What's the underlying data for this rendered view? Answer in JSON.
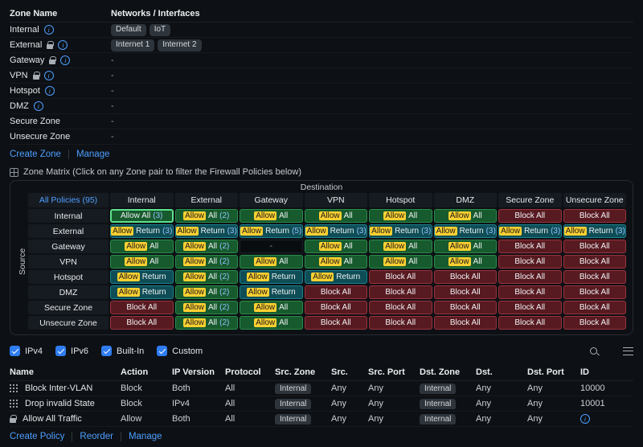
{
  "colors": {
    "accent": "#4d9fff",
    "allow_bg": "#175a2e",
    "allow_border": "#2c8c49",
    "return_bg": "#0f4d56",
    "return_border": "#1a828f",
    "block_bg": "#581a21",
    "block_border": "#99333d",
    "highlight_bg": "#fdd031",
    "count_text": "#8fc3ff",
    "selected_border": "#5fe08d"
  },
  "zones": {
    "columns": {
      "name": "Zone Name",
      "networks": "Networks / Interfaces"
    },
    "rows": [
      {
        "name": "Internal",
        "locked": false,
        "info": true,
        "networks": [
          "Default",
          "IoT"
        ]
      },
      {
        "name": "External",
        "locked": true,
        "info": true,
        "networks": [
          "Internet 1",
          "Internet 2"
        ]
      },
      {
        "name": "Gateway",
        "locked": true,
        "info": true,
        "networks": [],
        "empty": "-"
      },
      {
        "name": "VPN",
        "locked": true,
        "info": true,
        "networks": [],
        "empty": "-"
      },
      {
        "name": "Hotspot",
        "locked": false,
        "info": true,
        "networks": [],
        "empty": "-"
      },
      {
        "name": "DMZ",
        "locked": false,
        "info": true,
        "networks": [],
        "empty": "-"
      },
      {
        "name": "Secure Zone",
        "locked": false,
        "info": false,
        "networks": [],
        "empty": "-"
      },
      {
        "name": "Unsecure Zone",
        "locked": false,
        "info": false,
        "networks": [],
        "empty": "-"
      }
    ],
    "actions": [
      "Create Zone",
      "Manage"
    ]
  },
  "matrix": {
    "section_title": "Zone Matrix (Click on any Zone pair to filter the Firewall Policies below)",
    "destination_label": "Destination",
    "source_label": "Source",
    "all_policies_label": "All Policies (95)",
    "columns": [
      "Internal",
      "External",
      "Gateway",
      "VPN",
      "Hotspot",
      "DMZ",
      "Secure Zone",
      "Unsecure Zone"
    ],
    "rows": [
      {
        "label": "Internal",
        "cells": [
          {
            "type": "allow",
            "label": "Allow All",
            "count": "(3)",
            "highlighted": false,
            "selected": true
          },
          {
            "type": "allow",
            "label": "Allow All",
            "count": "(2)",
            "highlighted": true
          },
          {
            "type": "allow",
            "label": "Allow All",
            "highlighted": true
          },
          {
            "type": "allow",
            "label": "Allow All",
            "highlighted": true
          },
          {
            "type": "allow",
            "label": "Allow All",
            "highlighted": true
          },
          {
            "type": "allow",
            "label": "Allow All",
            "highlighted": true
          },
          {
            "type": "block",
            "label": "Block All"
          },
          {
            "type": "block",
            "label": "Block All"
          }
        ]
      },
      {
        "label": "External",
        "cells": [
          {
            "type": "return",
            "label": "Allow Return",
            "count": "(3)",
            "highlighted": true
          },
          {
            "type": "return",
            "label": "Allow Return",
            "count": "(3)",
            "highlighted": true
          },
          {
            "type": "return",
            "label": "Allow Return",
            "count": "(5)",
            "highlighted": true
          },
          {
            "type": "return",
            "label": "Allow Return",
            "count": "(3)",
            "highlighted": true
          },
          {
            "type": "return",
            "label": "Allow Return",
            "count": "(3)",
            "highlighted": true
          },
          {
            "type": "return",
            "label": "Allow Return",
            "count": "(3)",
            "highlighted": true
          },
          {
            "type": "return",
            "label": "Allow Return",
            "count": "(3)",
            "highlighted": true
          },
          {
            "type": "return",
            "label": "Allow Return",
            "count": "(3)",
            "highlighted": true
          }
        ]
      },
      {
        "label": "Gateway",
        "cells": [
          {
            "type": "allow",
            "label": "Allow All",
            "highlighted": true
          },
          {
            "type": "allow",
            "label": "Allow All",
            "count": "(2)",
            "highlighted": true
          },
          {
            "type": "none",
            "label": "-"
          },
          {
            "type": "allow",
            "label": "Allow All",
            "highlighted": true
          },
          {
            "type": "allow",
            "label": "Allow All",
            "highlighted": true
          },
          {
            "type": "allow",
            "label": "Allow All",
            "highlighted": true
          },
          {
            "type": "block",
            "label": "Block All"
          },
          {
            "type": "block",
            "label": "Block All"
          }
        ]
      },
      {
        "label": "VPN",
        "cells": [
          {
            "type": "allow",
            "label": "Allow All",
            "highlighted": true
          },
          {
            "type": "allow",
            "label": "Allow All",
            "count": "(2)",
            "highlighted": true
          },
          {
            "type": "allow",
            "label": "Allow All",
            "highlighted": true
          },
          {
            "type": "allow",
            "label": "Allow All",
            "highlighted": true
          },
          {
            "type": "allow",
            "label": "Allow All",
            "highlighted": true
          },
          {
            "type": "allow",
            "label": "Allow All",
            "highlighted": true
          },
          {
            "type": "block",
            "label": "Block All"
          },
          {
            "type": "block",
            "label": "Block All"
          }
        ]
      },
      {
        "label": "Hotspot",
        "cells": [
          {
            "type": "return",
            "label": "Allow Return",
            "highlighted": true
          },
          {
            "type": "allow",
            "label": "Allow All",
            "count": "(2)",
            "highlighted": true
          },
          {
            "type": "return",
            "label": "Allow Return",
            "highlighted": true
          },
          {
            "type": "return",
            "label": "Allow Return",
            "highlighted": true
          },
          {
            "type": "block",
            "label": "Block All"
          },
          {
            "type": "block",
            "label": "Block All"
          },
          {
            "type": "block",
            "label": "Block All"
          },
          {
            "type": "block",
            "label": "Block All"
          }
        ]
      },
      {
        "label": "DMZ",
        "cells": [
          {
            "type": "return",
            "label": "Allow Return",
            "highlighted": true
          },
          {
            "type": "allow",
            "label": "Allow All",
            "count": "(2)",
            "highlighted": true
          },
          {
            "type": "return",
            "label": "Allow Return",
            "highlighted": true
          },
          {
            "type": "block",
            "label": "Block All"
          },
          {
            "type": "block",
            "label": "Block All"
          },
          {
            "type": "block",
            "label": "Block All"
          },
          {
            "type": "block",
            "label": "Block All"
          },
          {
            "type": "block",
            "label": "Block All"
          }
        ]
      },
      {
        "label": "Secure Zone",
        "cells": [
          {
            "type": "block",
            "label": "Block All"
          },
          {
            "type": "allow",
            "label": "Allow All",
            "count": "(2)",
            "highlighted": true
          },
          {
            "type": "allow",
            "label": "Allow All",
            "highlighted": true
          },
          {
            "type": "block",
            "label": "Block All"
          },
          {
            "type": "block",
            "label": "Block All"
          },
          {
            "type": "block",
            "label": "Block All"
          },
          {
            "type": "block",
            "label": "Block All"
          },
          {
            "type": "block",
            "label": "Block All"
          }
        ]
      },
      {
        "label": "Unsecure Zone",
        "cells": [
          {
            "type": "block",
            "label": "Block All"
          },
          {
            "type": "allow",
            "label": "Allow All",
            "count": "(2)",
            "highlighted": true
          },
          {
            "type": "allow",
            "label": "Allow All",
            "highlighted": true
          },
          {
            "type": "block",
            "label": "Block All"
          },
          {
            "type": "block",
            "label": "Block All"
          },
          {
            "type": "block",
            "label": "Block All"
          },
          {
            "type": "block",
            "label": "Block All"
          },
          {
            "type": "block",
            "label": "Block All"
          }
        ]
      }
    ]
  },
  "filters": {
    "checkboxes": [
      {
        "label": "IPv4",
        "checked": true
      },
      {
        "label": "IPv6",
        "checked": true
      },
      {
        "label": "Built-In",
        "checked": true
      },
      {
        "label": "Custom",
        "checked": true
      }
    ]
  },
  "policies": {
    "columns": [
      "Name",
      "Action",
      "IP Version",
      "Protocol",
      "Src. Zone",
      "Src.",
      "Src. Port",
      "Dst. Zone",
      "Dst.",
      "Dst. Port",
      "ID"
    ],
    "rows": [
      {
        "icon": "matrix",
        "name": "Block Inter-VLAN",
        "action": "Block",
        "ip_version": "Both",
        "protocol": "All",
        "src_zone": "Internal",
        "src": "Any",
        "src_port": "Any",
        "dst_zone": "Internal",
        "dst": "Any",
        "dst_port": "Any",
        "id": "10000",
        "id_is_info": false
      },
      {
        "icon": "matrix",
        "name": "Drop invalid State",
        "action": "Block",
        "ip_version": "IPv4",
        "protocol": "All",
        "src_zone": "Internal",
        "src": "Any",
        "src_port": "Any",
        "dst_zone": "Internal",
        "dst": "Any",
        "dst_port": "Any",
        "id": "10001",
        "id_is_info": false
      },
      {
        "icon": "lock",
        "name": "Allow All Traffic",
        "action": "Allow",
        "ip_version": "Both",
        "protocol": "All",
        "src_zone": "Internal",
        "src": "Any",
        "src_port": "Any",
        "dst_zone": "Internal",
        "dst": "Any",
        "dst_port": "Any",
        "id": "",
        "id_is_info": true
      }
    ],
    "actions": [
      "Create Policy",
      "Reorder",
      "Manage"
    ]
  }
}
